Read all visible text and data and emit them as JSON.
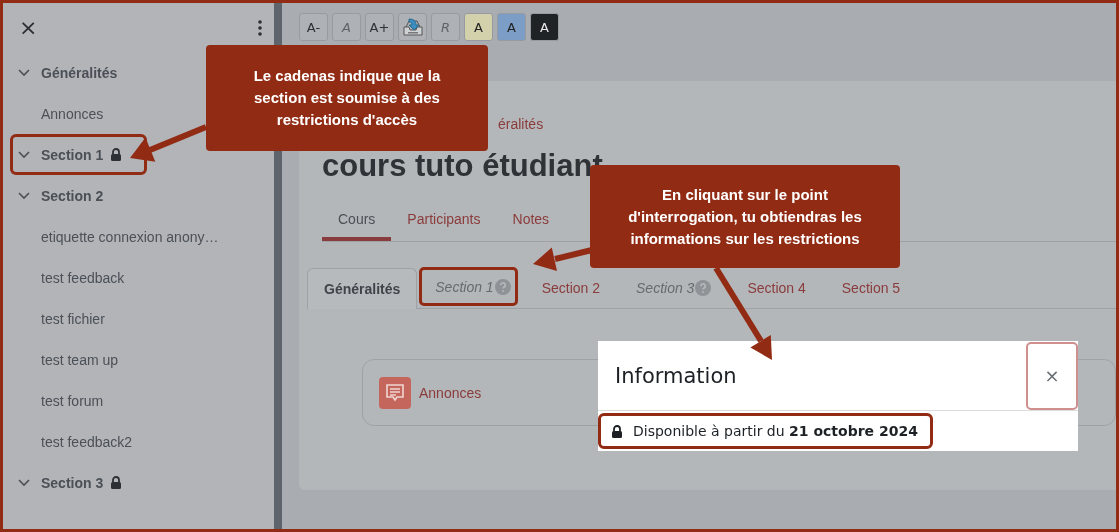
{
  "sidebar": {
    "close": "×",
    "items": [
      {
        "label": "Généralités",
        "expanded": true,
        "locked": false,
        "highlighted": false,
        "children": [
          {
            "label": "Annonces"
          }
        ]
      },
      {
        "label": "Section 1",
        "expanded": true,
        "locked": true,
        "highlighted": true
      },
      {
        "label": "Section 2",
        "expanded": true,
        "locked": false,
        "highlighted": false,
        "children": [
          {
            "label": "etiquette connexion anony…"
          },
          {
            "label": "test feedback"
          },
          {
            "label": "test fichier"
          },
          {
            "label": "test team up"
          },
          {
            "label": "test forum"
          },
          {
            "label": "test feedback2"
          }
        ]
      },
      {
        "label": "Section 3",
        "expanded": true,
        "locked": true,
        "highlighted": false
      }
    ]
  },
  "toolbar": {
    "buttons": [
      {
        "kind": "text",
        "label": "A-",
        "disabled": false
      },
      {
        "kind": "text",
        "label": "A",
        "disabled": true
      },
      {
        "kind": "text",
        "label": "A+",
        "disabled": false
      },
      {
        "kind": "icon"
      },
      {
        "kind": "text",
        "label": "R",
        "disabled": true
      },
      {
        "kind": "swatch",
        "label": "A",
        "color": "#d2d1ab"
      },
      {
        "kind": "swatch",
        "label": "A",
        "color": "#7c9dc6"
      },
      {
        "kind": "swatch",
        "label": "A",
        "color": "#1f2326"
      }
    ]
  },
  "course": {
    "breadcrumb": "éralités",
    "title": "cours tuto étudiant",
    "tabs": [
      {
        "label": "Cours",
        "selected": true
      },
      {
        "label": "Participants",
        "selected": false
      },
      {
        "label": "Notes",
        "selected": false
      }
    ],
    "section_tabs": [
      {
        "label": "Généralités",
        "selected": true,
        "restricted": false,
        "highlighted": false
      },
      {
        "label": "Section 1",
        "selected": false,
        "restricted": true,
        "highlighted": true
      },
      {
        "label": "Section 2",
        "selected": false,
        "restricted": false,
        "highlighted": false
      },
      {
        "label": "Section 3",
        "selected": false,
        "restricted": true,
        "highlighted": false
      },
      {
        "label": "Section 4",
        "selected": false,
        "restricted": false,
        "highlighted": false
      },
      {
        "label": "Section 5",
        "selected": false,
        "restricted": false,
        "highlighted": false
      }
    ],
    "activities": [
      {
        "label": "Annonces"
      }
    ]
  },
  "modal": {
    "title": "Information",
    "close": "×",
    "message": "Disponible à partir du **21 octobre 2024**",
    "highlighted": true
  },
  "callouts": [
    {
      "text": "Le cadenas indique que la section est soumise à des restrictions d'accès"
    },
    {
      "text": "En cliquant sur le point d'interrogation, tu obtiendras les informations sur les restrictions"
    }
  ]
}
